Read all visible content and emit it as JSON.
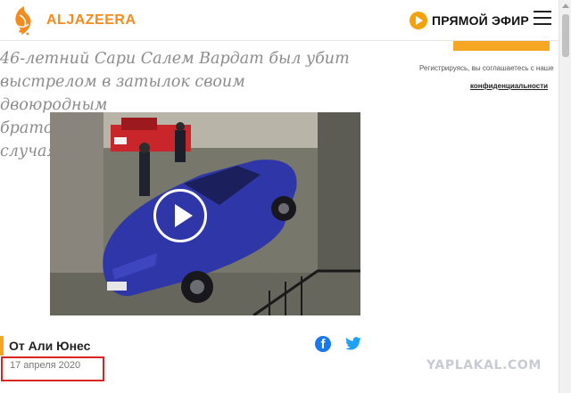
{
  "header": {
    "brand": "ALJAZEERA",
    "live_label": "ПРЯМОЙ ЭФИР",
    "logo_icon": "aljazeera-logo-icon",
    "menu_icon": "hamburger-menu-icon",
    "accent_color": "#f58b1f"
  },
  "subscribe": {
    "register_note": "Регистрируясь, вы соглашаетесь с наше",
    "privacy_link": "конфиденциальности"
  },
  "article": {
    "summary_lines": [
      "46-летний Сари Салем Вардат был убит",
      "выстрелом в затылок своим двоюродным",
      "братом в результате несчастного случая."
    ],
    "video_icon": "play-icon",
    "author": "От Али Юнес",
    "date": "17 апреля 2020",
    "share_icons": [
      "facebook-icon",
      "twitter-icon"
    ]
  },
  "watermark": "YAPLAKAL.COM"
}
